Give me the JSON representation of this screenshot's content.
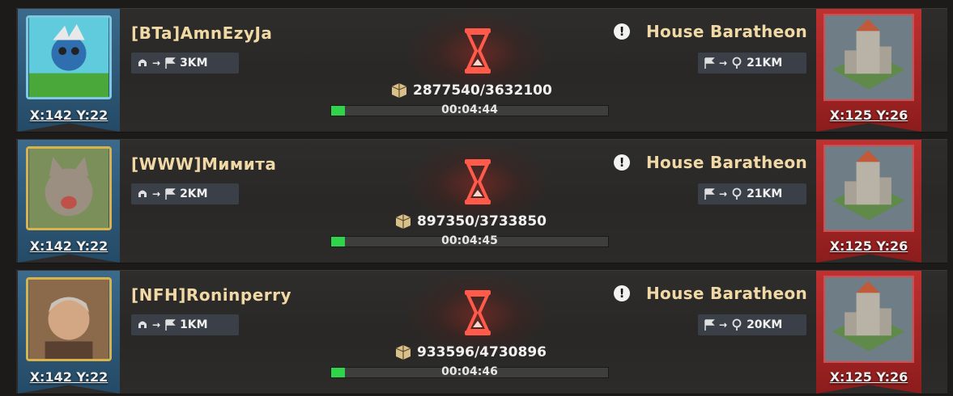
{
  "marches": [
    {
      "player_name": "[BTa]AmnEzyJa",
      "player_coords": "X:142 Y:22",
      "avatar_style": "cyan",
      "march_distance": "3KM",
      "resources": "2877540/3632100",
      "timer": "00:04:44",
      "progress": 0.05,
      "target_name": "House Baratheon",
      "target_distance": "21KM",
      "target_coords": "X:125 Y:26"
    },
    {
      "player_name": "[WWW]Мимита",
      "player_coords": "X:142 Y:22",
      "avatar_style": "gold",
      "march_distance": "2KM",
      "resources": "897350/3733850",
      "timer": "00:04:45",
      "progress": 0.05,
      "target_name": "House Baratheon",
      "target_distance": "21KM",
      "target_coords": "X:125 Y:26"
    },
    {
      "player_name": "[NFH]Roninperry",
      "player_coords": "X:142 Y:22",
      "avatar_style": "gold",
      "march_distance": "1KM",
      "resources": "933596/4730896",
      "timer": "00:04:46",
      "progress": 0.05,
      "target_name": "House Baratheon",
      "target_distance": "20KM",
      "target_coords": "X:125 Y:26"
    }
  ],
  "icons": {
    "march": "helmet-arrow-flag-icon",
    "target": "flag-arrow-pin-icon",
    "resource": "resource-cube-icon",
    "timer": "hourglass-icon",
    "alert": "alert-icon"
  },
  "colors": {
    "name_text": "#f1d9a6",
    "progress_fill": "#2fd44a",
    "target_banner": "#c03030",
    "player_banner": "#3b6a8c",
    "hourglass": "#ff5a4a"
  }
}
